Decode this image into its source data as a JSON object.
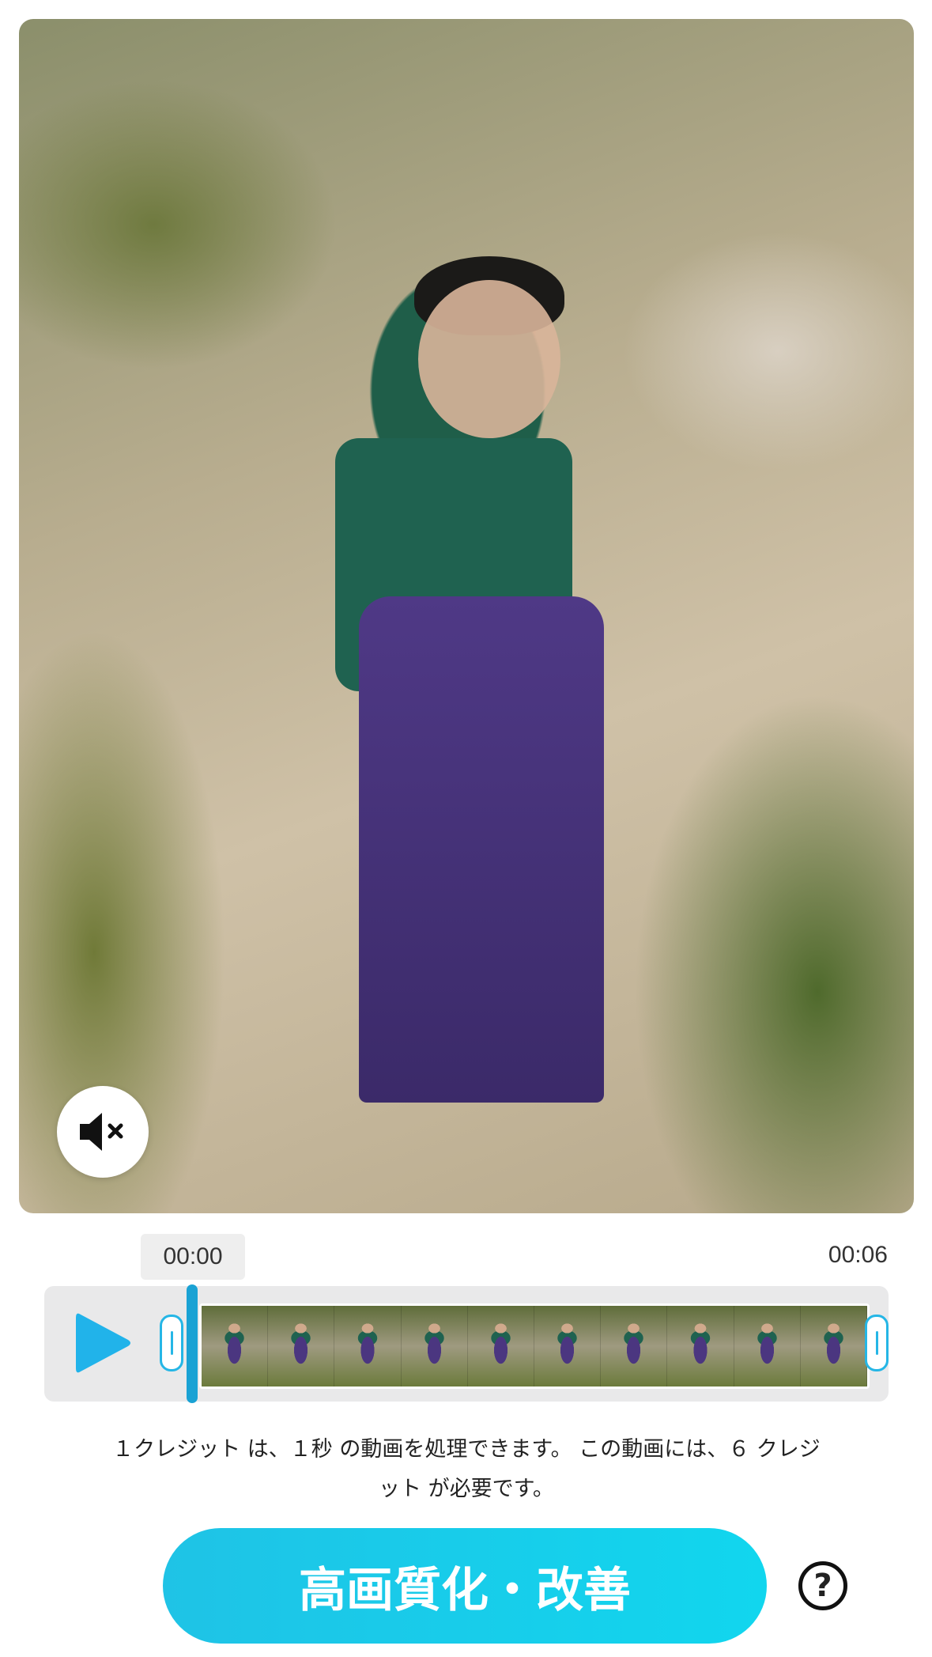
{
  "video": {
    "mute_icon": "speaker-muted-icon"
  },
  "timeline": {
    "time_start": "00:00",
    "time_end": "00:06",
    "play_icon": "play-icon",
    "frame_count": 10
  },
  "info": {
    "credit_line_1": "１クレジット は、１秒 の動画を処理できます。 この動画には、６ クレジ",
    "credit_line_2": "ット が必要です。"
  },
  "actions": {
    "enhance_label": "高画質化・改善",
    "help_label": "?"
  },
  "colors": {
    "accent": "#1fc3e6",
    "playhead": "#1aa2d4"
  }
}
